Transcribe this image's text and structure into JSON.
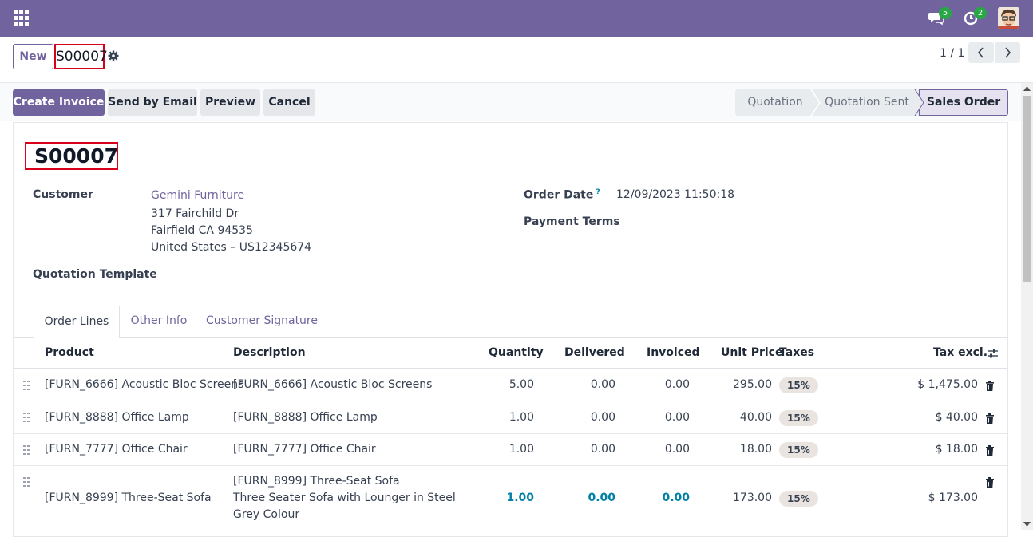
{
  "navbar": {
    "chat_count": "5",
    "activity_count": "2"
  },
  "control": {
    "new_label": "New",
    "record": "S00007",
    "pager": "1 / 1"
  },
  "actions": {
    "create_invoice": "Create Invoice",
    "send_email": "Send by Email",
    "preview": "Preview",
    "cancel": "Cancel"
  },
  "status": {
    "stages": [
      "Quotation",
      "Quotation Sent",
      "Sales Order"
    ],
    "active": "Sales Order"
  },
  "form": {
    "title": "S00007",
    "customer_label": "Customer",
    "customer_name": "Gemini Furniture",
    "address": [
      "317 Fairchild Dr",
      "Fairfield CA 94535",
      "United States – US12345674"
    ],
    "template_label": "Quotation Template",
    "order_date_label": "Order Date",
    "help_mark": "?",
    "order_date": "12/09/2023 11:50:18",
    "payment_terms_label": "Payment Terms"
  },
  "tabs": [
    "Order Lines",
    "Other Info",
    "Customer Signature"
  ],
  "columns": {
    "product": "Product",
    "description": "Description",
    "quantity": "Quantity",
    "delivered": "Delivered",
    "invoiced": "Invoiced",
    "unit_price": "Unit Price",
    "taxes": "Taxes",
    "tax_excl": "Tax excl."
  },
  "lines": [
    {
      "product": "[FURN_6666] Acoustic Bloc Screens",
      "description": [
        "[FURN_6666] Acoustic Bloc Screens"
      ],
      "quantity": "5.00",
      "delivered": "0.00",
      "invoiced": "0.00",
      "unit_price": "295.00",
      "tax": "15%",
      "subtotal": "$ 1,475.00"
    },
    {
      "product": "[FURN_8888] Office Lamp",
      "description": [
        "[FURN_8888] Office Lamp"
      ],
      "quantity": "1.00",
      "delivered": "0.00",
      "invoiced": "0.00",
      "unit_price": "40.00",
      "tax": "15%",
      "subtotal": "$ 40.00"
    },
    {
      "product": "[FURN_7777] Office Chair",
      "description": [
        "[FURN_7777] Office Chair"
      ],
      "quantity": "1.00",
      "delivered": "0.00",
      "invoiced": "0.00",
      "unit_price": "18.00",
      "tax": "15%",
      "subtotal": "$ 18.00"
    },
    {
      "product": "[FURN_8999] Three-Seat Sofa",
      "description": [
        "[FURN_8999] Three-Seat Sofa",
        "Three Seater Sofa with Lounger in Steel",
        "Grey Colour"
      ],
      "quantity": "1.00",
      "delivered": "0.00",
      "invoiced": "0.00",
      "unit_price": "173.00",
      "tax": "15%",
      "subtotal": "$ 173.00"
    }
  ],
  "colors": {
    "brand": "#71639e",
    "highlight": "#d9001b",
    "link_blue": "#0180a5"
  }
}
